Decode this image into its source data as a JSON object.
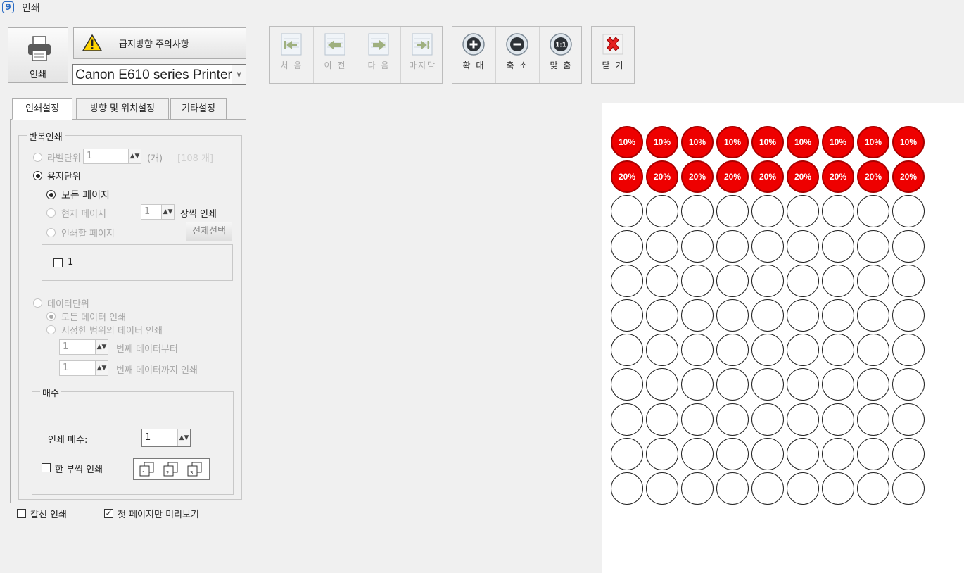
{
  "window": {
    "title": "인쇄",
    "icon": "app-logo-icon"
  },
  "print_button": {
    "label": "인쇄",
    "icon": "printer-icon"
  },
  "warning_button": {
    "label": "급지방향 주의사항",
    "icon": "warning-icon"
  },
  "printer_select": {
    "value": "Canon E610 series Printer"
  },
  "tabs": [
    {
      "label": "인쇄설정",
      "active": true
    },
    {
      "label": "방향 및 위치설정",
      "active": false
    },
    {
      "label": "기타설정",
      "active": false
    }
  ],
  "repeat_group": {
    "title": "반복인쇄",
    "label_unit": {
      "label": "라벨단위",
      "value": "1",
      "unit": "(개)",
      "total": "[108 개]",
      "selected": false
    },
    "paper_unit": {
      "label": "용지단위",
      "selected": true,
      "all_pages": {
        "label": "모든 페이지",
        "selected": true
      },
      "current_page": {
        "label": "현재 페이지",
        "value": "1",
        "suffix": "장씩 인쇄",
        "selected": false
      },
      "pages_to_print": {
        "label": "인쇄할 페이지",
        "select_all": "전체선택",
        "selected": false
      },
      "page_list": [
        {
          "label": "1",
          "checked": false
        }
      ]
    },
    "data_unit": {
      "label": "데이터단위",
      "selected": false,
      "all_data": {
        "label": "모든 데이터 인쇄",
        "selected": true
      },
      "range": {
        "label": "지정한 범위의 데이터 인쇄",
        "selected": false
      },
      "from": {
        "value": "1",
        "label": "번째 데이터부터"
      },
      "to": {
        "value": "1",
        "label": "번째 데이터까지 인쇄"
      }
    }
  },
  "copies_group": {
    "title": "매수",
    "copies_label": "인쇄 매수:",
    "copies_value": "1",
    "collate": {
      "label": "한 부씩 인쇄",
      "checked": false
    },
    "collate_icons": [
      "collate-1-icon",
      "collate-2-icon",
      "collate-3-icon"
    ]
  },
  "bottom_options": {
    "cut_line": {
      "label": "칼선 인쇄",
      "checked": false
    },
    "first_page_only": {
      "label": "첫 페이지만 미리보기",
      "checked": true
    }
  },
  "toolbar": {
    "nav": [
      {
        "label": "처 음",
        "icon": "first-page-icon",
        "enabled": false
      },
      {
        "label": "이 전",
        "icon": "prev-page-icon",
        "enabled": false
      },
      {
        "label": "다 음",
        "icon": "next-page-icon",
        "enabled": false
      },
      {
        "label": "마지막",
        "icon": "last-page-icon",
        "enabled": false
      }
    ],
    "zoom": [
      {
        "label": "확 대",
        "icon": "zoom-in-icon",
        "glyph": "+"
      },
      {
        "label": "축 소",
        "icon": "zoom-out-icon",
        "glyph": "−"
      },
      {
        "label": "맞 춤",
        "icon": "fit-icon",
        "glyph": "1:1"
      }
    ],
    "close": {
      "label": "닫 기",
      "icon": "close-icon"
    }
  },
  "preview": {
    "columns": 9,
    "rows": 11,
    "filled_rows": [
      {
        "text": "10%",
        "color": "#ee0000"
      },
      {
        "text": "20%",
        "color": "#ee0000"
      }
    ]
  }
}
